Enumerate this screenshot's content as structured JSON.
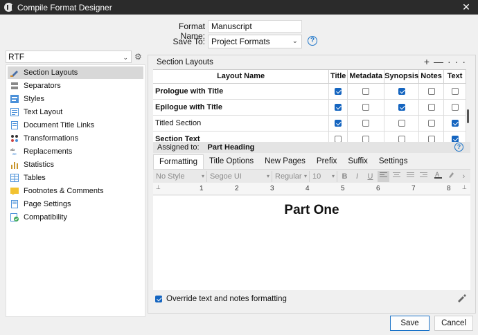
{
  "window": {
    "title": "Compile Format Designer",
    "close": "✕"
  },
  "form": {
    "format_name_label": "Format Name:",
    "format_name_value": "Manuscript",
    "save_to_label": "Save To:",
    "save_to_value": "Project Formats",
    "help": "?"
  },
  "sidebar": {
    "format_select": "RTF",
    "items": [
      {
        "label": "Section Layouts",
        "icon": "section-layouts-icon",
        "selected": true
      },
      {
        "label": "Separators",
        "icon": "separators-icon"
      },
      {
        "label": "Styles",
        "icon": "styles-icon"
      },
      {
        "label": "Text Layout",
        "icon": "text-layout-icon"
      },
      {
        "label": "Document Title Links",
        "icon": "document-title-links-icon"
      },
      {
        "label": "Transformations",
        "icon": "transformations-icon"
      },
      {
        "label": "Replacements",
        "icon": "replacements-icon"
      },
      {
        "label": "Statistics",
        "icon": "statistics-icon"
      },
      {
        "label": "Tables",
        "icon": "tables-icon"
      },
      {
        "label": "Footnotes & Comments",
        "icon": "footnotes-icon"
      },
      {
        "label": "Page Settings",
        "icon": "page-settings-icon"
      },
      {
        "label": "Compatibility",
        "icon": "compatibility-icon"
      }
    ]
  },
  "section_layouts": {
    "header": "Section Layouts",
    "actions": "+ — ···",
    "columns": [
      "Layout Name",
      "Title",
      "Metadata",
      "Synopsis",
      "Notes",
      "Text"
    ],
    "rows": [
      {
        "name": "Prologue with Title",
        "bold": true,
        "checks": [
          true,
          false,
          true,
          false,
          false
        ]
      },
      {
        "name": "Epilogue with Title",
        "bold": true,
        "checks": [
          true,
          false,
          true,
          false,
          false
        ]
      },
      {
        "name": "Titled Section",
        "bold": false,
        "checks": [
          true,
          false,
          false,
          false,
          true
        ]
      },
      {
        "name": "Section Text",
        "bold": true,
        "checks": [
          false,
          false,
          false,
          false,
          true
        ]
      }
    ]
  },
  "assigned": {
    "label": "Assigned to:",
    "value": "Part Heading"
  },
  "tabs": [
    "Formatting",
    "Title Options",
    "New Pages",
    "Prefix",
    "Suffix",
    "Settings"
  ],
  "toolbar": {
    "style": "No Style",
    "font": "Segoe UI",
    "weight": "Regular",
    "size": "10",
    "bold": "B",
    "italic": "I",
    "underline": "U"
  },
  "ruler": [
    "1",
    "2",
    "3",
    "4",
    "5",
    "6",
    "7",
    "8"
  ],
  "editor": {
    "heading": "Part One"
  },
  "override": {
    "label": "Override text and notes formatting",
    "checked": true
  },
  "buttons": {
    "save": "Save",
    "cancel": "Cancel"
  },
  "colors": {
    "accent": "#1565c0",
    "titlebar": "#2b2b2b"
  }
}
